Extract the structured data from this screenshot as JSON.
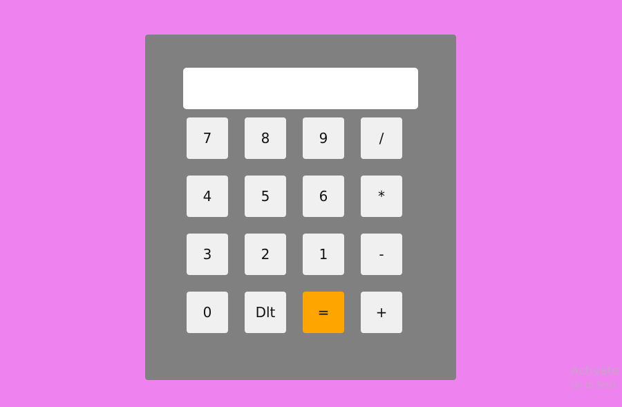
{
  "colors": {
    "background": "#ee82ee",
    "calculator_body": "#808080",
    "display_bg": "#ffffff",
    "key_bg": "#f0f0f0",
    "equals_key_bg": "#ffa500",
    "watermark_text": "#c9a2c9"
  },
  "display": {
    "value": ""
  },
  "keys": [
    {
      "label": "7",
      "role": "digit"
    },
    {
      "label": "8",
      "role": "digit"
    },
    {
      "label": "9",
      "role": "digit"
    },
    {
      "label": "/",
      "role": "operator"
    },
    {
      "label": "4",
      "role": "digit"
    },
    {
      "label": "5",
      "role": "digit"
    },
    {
      "label": "6",
      "role": "digit"
    },
    {
      "label": "*",
      "role": "operator"
    },
    {
      "label": "3",
      "role": "digit"
    },
    {
      "label": "2",
      "role": "digit"
    },
    {
      "label": "1",
      "role": "digit"
    },
    {
      "label": "-",
      "role": "operator"
    },
    {
      "label": "0",
      "role": "digit"
    },
    {
      "label": "Dlt",
      "role": "delete"
    },
    {
      "label": "=",
      "role": "equals"
    },
    {
      "label": "+",
      "role": "operator"
    }
  ],
  "watermark": {
    "title": "Activate",
    "subtitle": "Go to Setti"
  }
}
